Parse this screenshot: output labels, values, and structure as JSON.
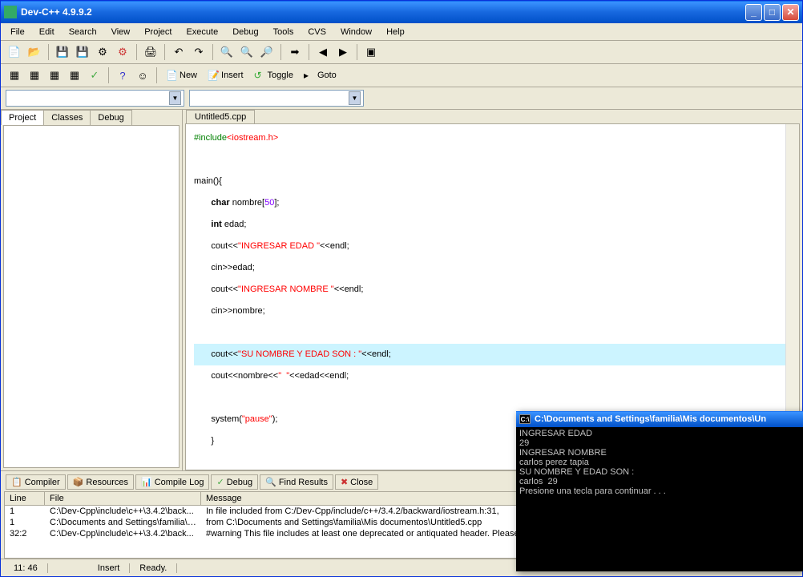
{
  "window": {
    "title": "Dev-C++ 4.9.9.2"
  },
  "menubar": [
    "File",
    "Edit",
    "Search",
    "View",
    "Project",
    "Execute",
    "Debug",
    "Tools",
    "CVS",
    "Window",
    "Help"
  ],
  "toolbar2": {
    "new": "New",
    "insert": "Insert",
    "toggle": "Toggle",
    "goto": "Goto"
  },
  "sidebar_tabs": [
    "Project",
    "Classes",
    "Debug"
  ],
  "editor": {
    "tab": "Untitled5.cpp",
    "code": {
      "l1_pp": "#include",
      "l1_inc": "<iostream.h>",
      "l3": "main(){",
      "l4_kw": "char",
      "l4_rest1": " nombre[",
      "l4_num": "50",
      "l4_rest2": "];",
      "l5_kw": "int",
      "l5_rest": " edad;",
      "l6_a": "cout<<",
      "l6_str": "\"INGRESAR EDAD \"",
      "l6_b": "<<endl;",
      "l7": "cin>>edad;",
      "l8_a": "cout<<",
      "l8_str": "\"INGRESAR NOMBRE \"",
      "l8_b": "<<endl;",
      "l9": "cin>>nombre;",
      "l11_a": "cout<<",
      "l11_str": "\"SU NOMBRE Y EDAD SON : \"",
      "l11_b": "<<endl;",
      "l12_a": "cout<<nombre<<",
      "l12_str": "\"  \"",
      "l12_b": "<<edad<<endl;",
      "l14_a": "system(",
      "l14_str": "\"pause\"",
      "l14_b": ");",
      "l15": "}"
    }
  },
  "bottom_tabs": [
    "Compiler",
    "Resources",
    "Compile Log",
    "Debug",
    "Find Results",
    "Close"
  ],
  "compiler": {
    "headers": {
      "line": "Line",
      "file": "File",
      "message": "Message"
    },
    "rows": [
      {
        "line": "1",
        "file": "C:\\Dev-Cpp\\include\\c++\\3.4.2\\back...",
        "message": "In file included from C:/Dev-Cpp/include/c++/3.4.2/backward/iostream.h:31,"
      },
      {
        "line": "1",
        "file": "C:\\Documents and Settings\\familia\\M...",
        "message": "                 from C:\\Documents and Settings\\familia\\Mis documentos\\Untitled5.cpp"
      },
      {
        "line": "32:2",
        "file": "C:\\Dev-Cpp\\include\\c++\\3.4.2\\back...",
        "message": "#warning This file includes at least one deprecated or antiquated header. Please co"
      }
    ]
  },
  "statusbar": {
    "pos": "11: 46",
    "mode": "Insert",
    "state": "Ready."
  },
  "console": {
    "title": "C:\\Documents and Settings\\familia\\Mis documentos\\Un",
    "lines": [
      "INGRESAR EDAD",
      "29",
      "INGRESAR NOMBRE",
      "carlos perez tapia",
      "SU NOMBRE Y EDAD SON :",
      "carlos  29",
      "Presione una tecla para continuar . . ."
    ]
  }
}
